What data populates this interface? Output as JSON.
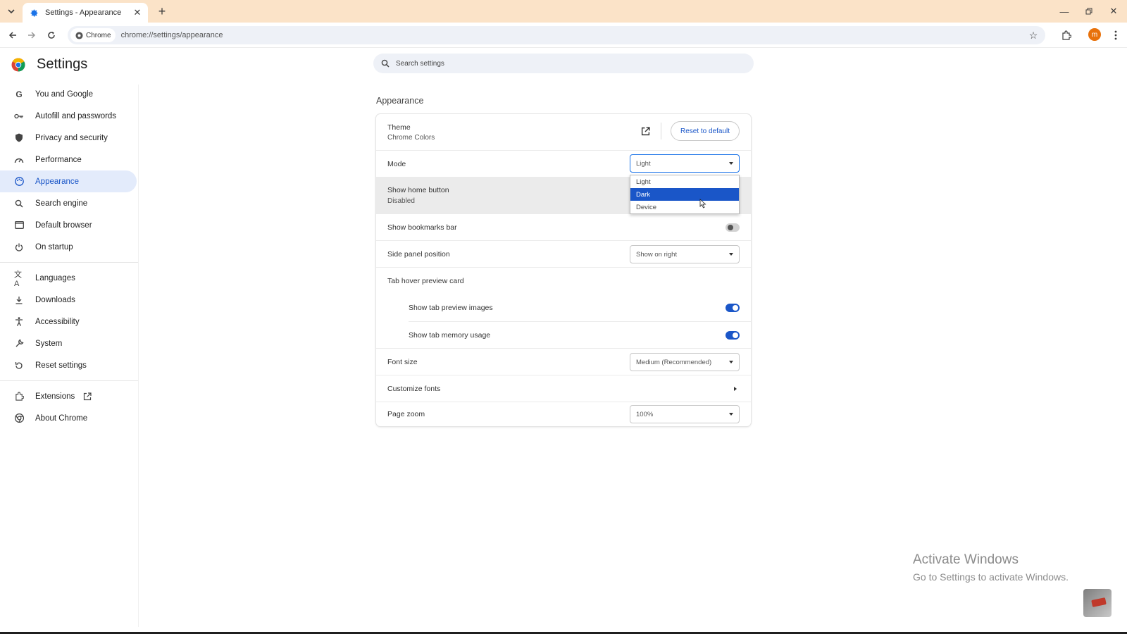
{
  "browser": {
    "tab_title": "Settings - Appearance",
    "chip_label": "Chrome",
    "url": "chrome://settings/appearance",
    "profile_initial": "m"
  },
  "header": {
    "title": "Settings",
    "search_placeholder": "Search settings"
  },
  "sidebar": {
    "items": [
      {
        "label": "You and Google",
        "icon": "google-g-icon"
      },
      {
        "label": "Autofill and passwords",
        "icon": "key-icon"
      },
      {
        "label": "Privacy and security",
        "icon": "shield-icon"
      },
      {
        "label": "Performance",
        "icon": "speedometer-icon"
      },
      {
        "label": "Appearance",
        "icon": "palette-icon",
        "active": true
      },
      {
        "label": "Search engine",
        "icon": "search-icon"
      },
      {
        "label": "Default browser",
        "icon": "browser-window-icon"
      },
      {
        "label": "On startup",
        "icon": "power-icon"
      },
      {
        "label": "Languages",
        "icon": "translate-icon"
      },
      {
        "label": "Downloads",
        "icon": "download-icon"
      },
      {
        "label": "Accessibility",
        "icon": "accessibility-icon"
      },
      {
        "label": "System",
        "icon": "wrench-icon"
      },
      {
        "label": "Reset settings",
        "icon": "reset-icon"
      },
      {
        "label": "Extensions",
        "icon": "puzzle-icon"
      },
      {
        "label": "About Chrome",
        "icon": "chrome-logo-icon"
      }
    ]
  },
  "appearance": {
    "section_title": "Appearance",
    "theme_label": "Theme",
    "theme_value": "Chrome Colors",
    "reset_label": "Reset to default",
    "mode_label": "Mode",
    "mode_value": "Light",
    "mode_options": [
      "Light",
      "Dark",
      "Device"
    ],
    "mode_highlighted": "Dark",
    "home_button_label": "Show home button",
    "home_button_value": "Disabled",
    "bookmarks_label": "Show bookmarks bar",
    "bookmarks_on": false,
    "side_panel_label": "Side panel position",
    "side_panel_value": "Show on right",
    "hover_card_label": "Tab hover preview card",
    "preview_images_label": "Show tab preview images",
    "preview_images_on": true,
    "memory_usage_label": "Show tab memory usage",
    "memory_usage_on": true,
    "font_size_label": "Font size",
    "font_size_value": "Medium (Recommended)",
    "customize_fonts_label": "Customize fonts",
    "page_zoom_label": "Page zoom",
    "page_zoom_value": "100%"
  },
  "watermark": {
    "line1": "Activate Windows",
    "line2": "Go to Settings to activate Windows."
  },
  "colors": {
    "tabstrip": "#fbe3c8",
    "accent": "#1a56c8",
    "active_nav_bg": "#e3ebfb",
    "profile": "#e8710a"
  }
}
